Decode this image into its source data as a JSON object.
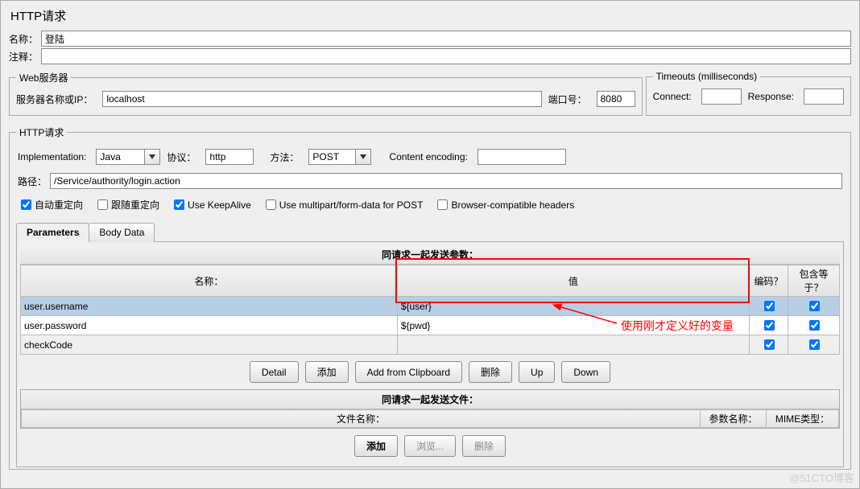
{
  "title": "HTTP请求",
  "labels": {
    "name": "名称：",
    "comment": "注释：",
    "server_ip": "服务器名称或IP：",
    "port": "端口号：",
    "connect": "Connect:",
    "response": "Response:",
    "implementation": "Implementation:",
    "protocol": "协议：",
    "method": "方法：",
    "content_encoding": "Content encoding:",
    "path": "路径："
  },
  "values": {
    "name": "登陆",
    "comment": "",
    "server_ip": "localhost",
    "port": "8080",
    "connect": "",
    "response": "",
    "implementation": "Java",
    "protocol": "http",
    "method": "POST",
    "content_encoding": "",
    "path": "/Service/authority/login.action"
  },
  "legends": {
    "web_server": "Web服务器",
    "timeouts": "Timeouts (milliseconds)",
    "http_request": "HTTP请求"
  },
  "checkboxes": {
    "auto_redirect": {
      "label": "自动重定向",
      "checked": true
    },
    "follow_redirect": {
      "label": "跟随重定向",
      "checked": false
    },
    "keepalive": {
      "label": "Use KeepAlive",
      "checked": true
    },
    "multipart": {
      "label": "Use multipart/form-data for POST",
      "checked": false
    },
    "browser_compat": {
      "label": "Browser-compatible headers",
      "checked": false
    }
  },
  "tabs": {
    "parameters": "Parameters",
    "body_data": "Body Data"
  },
  "params_section": {
    "title": "同请求一起发送参数：",
    "cols": {
      "name": "名称：",
      "value": "值",
      "encode": "编码？",
      "include_equals": "包含等于？"
    },
    "rows": [
      {
        "name": "user.username",
        "value": "${user}",
        "enc": true,
        "eq": true,
        "selected": true
      },
      {
        "name": "user.password",
        "value": "${pwd}",
        "enc": true,
        "eq": true,
        "selected": false
      },
      {
        "name": "checkCode",
        "value": "",
        "enc": true,
        "eq": true,
        "selected": false
      }
    ]
  },
  "annotation": "使用刚才定义好的变量",
  "buttons": {
    "detail": "Detail",
    "add": "添加",
    "add_clipboard": "Add from Clipboard",
    "delete": "删除",
    "up": "Up",
    "down": "Down",
    "browse": "浏览..."
  },
  "files_section": {
    "title": "同请求一起发送文件：",
    "cols": {
      "filename": "文件名称：",
      "paramname": "参数名称：",
      "mime": "MIME类型："
    }
  },
  "watermark": "@51CTO博客"
}
